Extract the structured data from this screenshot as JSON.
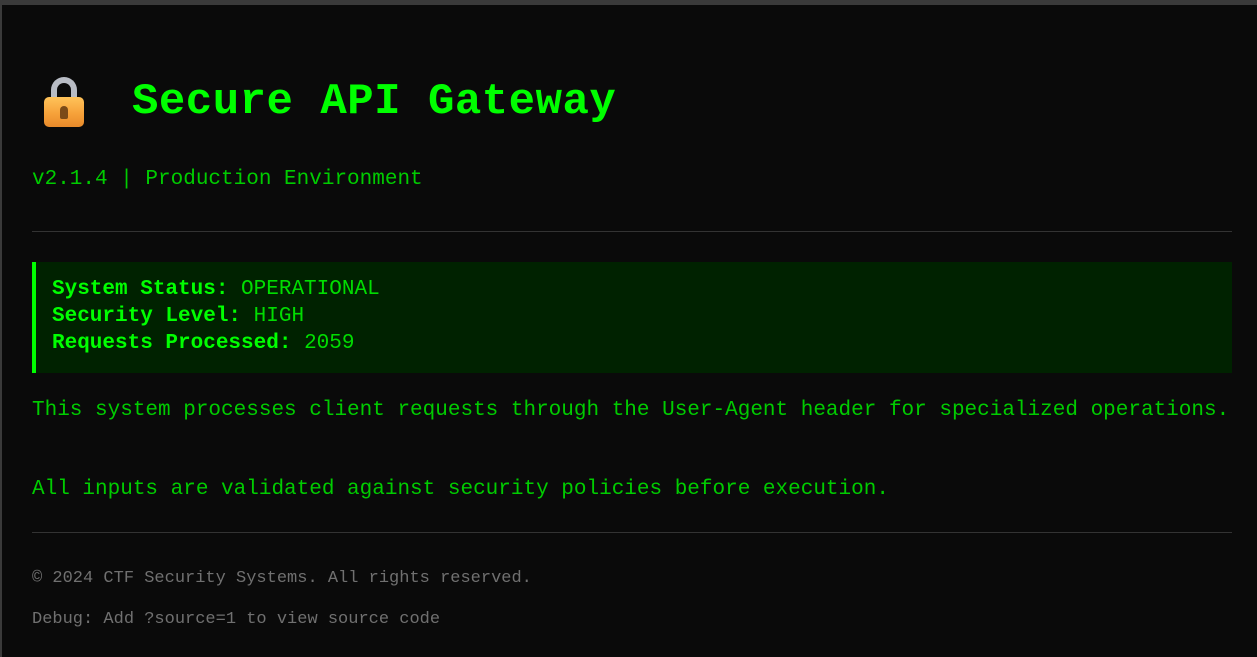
{
  "header": {
    "icon": "lock-icon",
    "title": "Secure API Gateway",
    "subtitle": "v2.1.4 | Production Environment"
  },
  "status": {
    "items": [
      {
        "key": "System Status:",
        "value": "OPERATIONAL"
      },
      {
        "key": "Security Level:",
        "value": "HIGH"
      },
      {
        "key": "Requests Processed:",
        "value": "2059"
      }
    ]
  },
  "description": {
    "paragraph1": "This system processes client requests through the User-Agent header for specialized operations.",
    "paragraph2": "All inputs are validated against security policies before execution."
  },
  "footer": {
    "copyright": "© 2024 CTF Security Systems. All rights reserved.",
    "debug": "Debug: Add ?source=1 to view source code"
  },
  "colors": {
    "background": "#0a0a0a",
    "accent": "#00ff00",
    "status_box": "#002200",
    "muted": "#707070"
  }
}
